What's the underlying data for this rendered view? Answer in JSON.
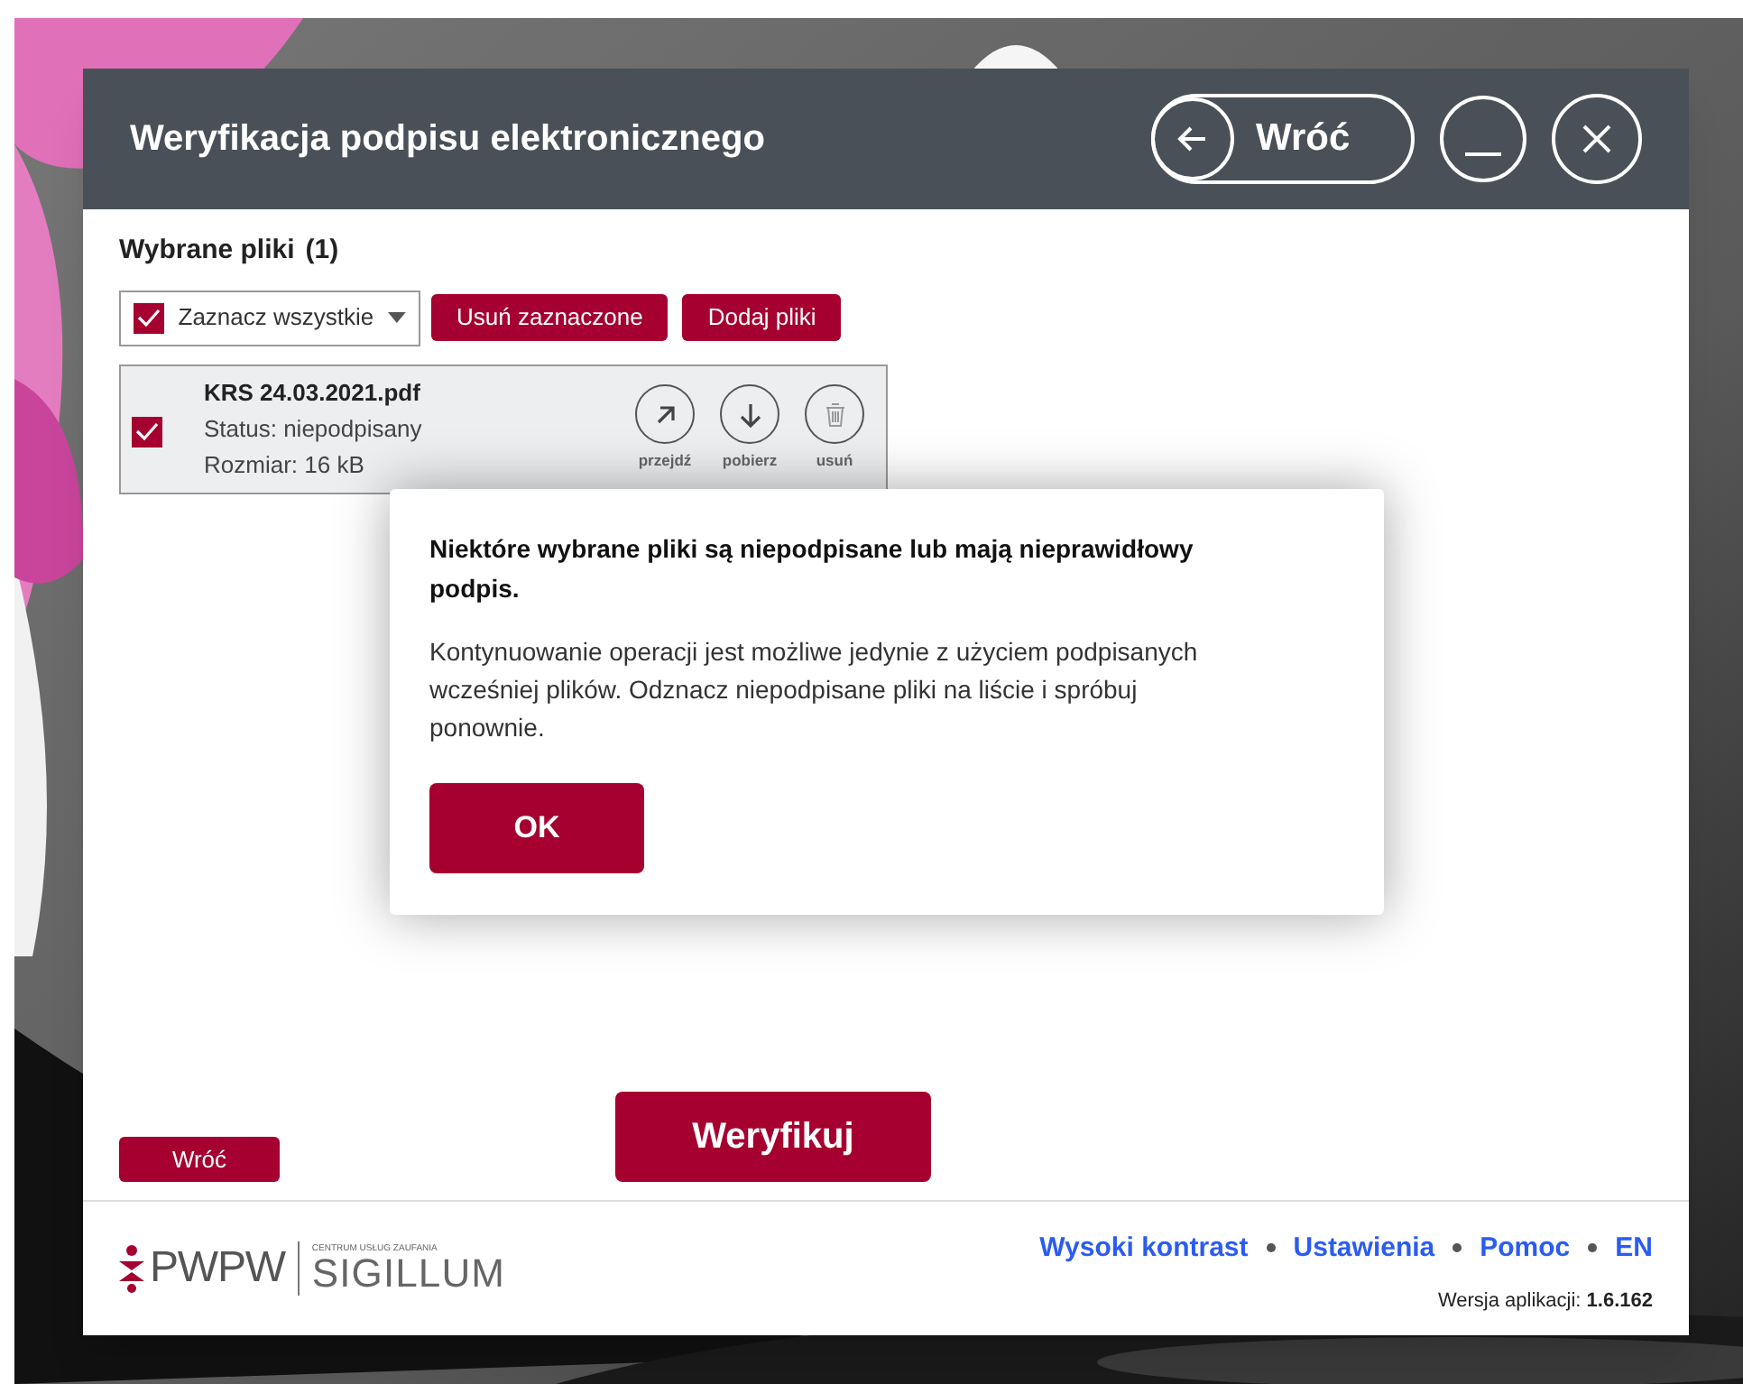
{
  "window": {
    "title": "Weryfikacja podpisu elektronicznego",
    "back_button": "Wróć"
  },
  "files_section": {
    "title": "Wybrane pliki",
    "count": "(1)",
    "select_all": {
      "label": "Zaznacz wszystkie",
      "checked": true
    },
    "buttons": [
      "Usuń zaznaczone",
      "Dodaj pliki"
    ],
    "files": [
      {
        "name": "KRS 24.03.2021.pdf",
        "status": "Status: niepodpisany",
        "size": "Rozmiar: 16 kB",
        "checked": true,
        "actions": [
          {
            "kind": "open",
            "label": "przejdź"
          },
          {
            "kind": "download",
            "label": "pobierz"
          },
          {
            "kind": "delete",
            "label": "usuń"
          }
        ]
      }
    ]
  },
  "dialog": {
    "title": "Niektóre wybrane pliki są niepodpisane lub mają nieprawidłowy podpis.",
    "message": "Kontynuowanie operacji jest możliwe jedynie z użyciem podpisanych wcześniej plików. Odznacz niepodpisane pliki na liście i spróbuj ponownie.",
    "button": "OK"
  },
  "bottom": {
    "back_button": "Wróć",
    "primary_button": "Weryfikuj"
  },
  "footer": {
    "logo": {
      "brand": "PWPW",
      "subtitle": "CENTRUM USŁUG ZAUFANIA",
      "name": "SIGILLUM"
    },
    "links": [
      "Wysoki kontrast",
      "Ustawienia",
      "Pomoc",
      "EN"
    ],
    "version": "Wersja aplikacji: **1.6.162**"
  }
}
